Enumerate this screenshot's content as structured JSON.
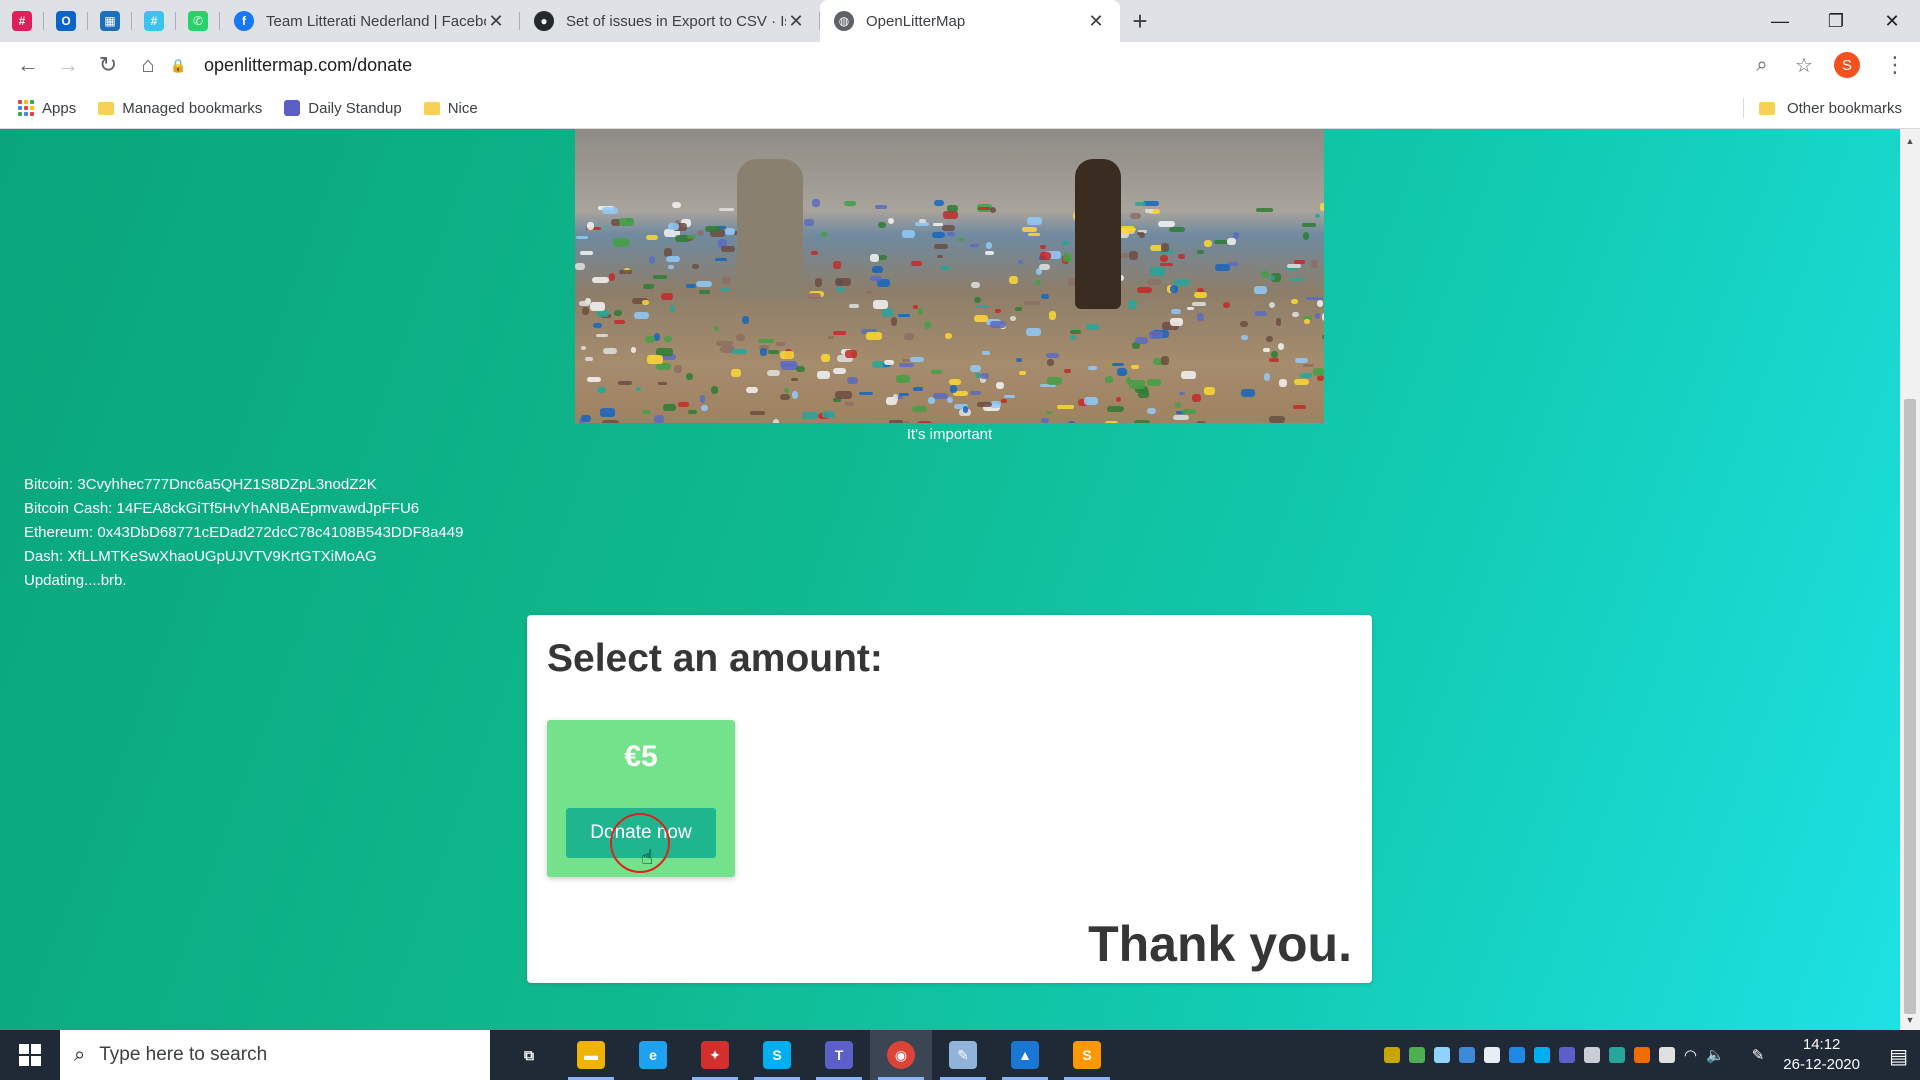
{
  "browser": {
    "pinned_tabs": [
      {
        "name": "slack-icon",
        "color": "#e01e5a",
        "glyph": "#"
      },
      {
        "name": "outlook-icon",
        "color": "#0a64c8",
        "glyph": "O"
      },
      {
        "name": "planner-icon",
        "color": "#1e6fbb",
        "glyph": "▦"
      },
      {
        "name": "slack-icon",
        "color": "#36c5f0",
        "glyph": "#"
      },
      {
        "name": "whatsapp-icon",
        "color": "#25d366",
        "glyph": "✆"
      }
    ],
    "tabs": [
      {
        "title": "Team Litterati Nederland | Facebo",
        "favicon": "facebook-icon",
        "favicon_color": "#1877f2",
        "favicon_glyph": "f"
      },
      {
        "title": "Set of issues in Export to CSV · Is",
        "favicon": "github-icon",
        "favicon_color": "#24292e",
        "favicon_glyph": "●"
      },
      {
        "title": "OpenLitterMap",
        "favicon": "globe-icon",
        "favicon_color": "#5f6368",
        "favicon_glyph": "◍"
      }
    ],
    "url": "openlittermap.com/donate",
    "profile_initial": "S",
    "bookmarks": {
      "apps": "Apps",
      "items": [
        "Managed bookmarks",
        "Daily Standup",
        "Nice"
      ],
      "other": "Other bookmarks"
    }
  },
  "page": {
    "photo_caption": "It's important",
    "crypto_lines": [
      "Bitcoin: 3Cvyhhec777Dnc6a5QHZ1S8DZpL3nodZ2K",
      "Bitcoin Cash: 14FEA8ckGiTf5HvYhANBAEpmvawdJpFFU6",
      "Ethereum: 0x43DbD68771cEDad272dcC78c4108B543DDF8a449",
      "Dash: XfLLMTKeSwXhaoUGpUJVTV9KrtGTXiMoAG",
      "Updating....brb."
    ],
    "card": {
      "title": "Select an amount:",
      "amount": "€5",
      "donate_button": "Donate now",
      "thanks": "Thank you."
    }
  },
  "taskbar": {
    "search_placeholder": "Type here to search",
    "time": "14:12",
    "date": "26-12-2020",
    "apps": [
      {
        "name": "task-view-icon",
        "color": "#1f2a36",
        "glyph": "⧉"
      },
      {
        "name": "file-explorer-icon",
        "color": "#f0b400",
        "glyph": "▬"
      },
      {
        "name": "internet-explorer-icon",
        "color": "#1ea1f1",
        "glyph": "e"
      },
      {
        "name": "red-app-icon",
        "color": "#d32f2f",
        "glyph": "✦"
      },
      {
        "name": "skype-icon",
        "color": "#00aff0",
        "glyph": "S"
      },
      {
        "name": "teams-icon",
        "color": "#5b5fc7",
        "glyph": "T"
      },
      {
        "name": "chrome-icon",
        "color": "#db4437",
        "glyph": "◉"
      },
      {
        "name": "notes-app-icon",
        "color": "#8fb3d9",
        "glyph": "✎"
      },
      {
        "name": "photos-icon",
        "color": "#1976d2",
        "glyph": "▲"
      },
      {
        "name": "sublime-text-icon",
        "color": "#ff9800",
        "glyph": "S"
      }
    ]
  }
}
